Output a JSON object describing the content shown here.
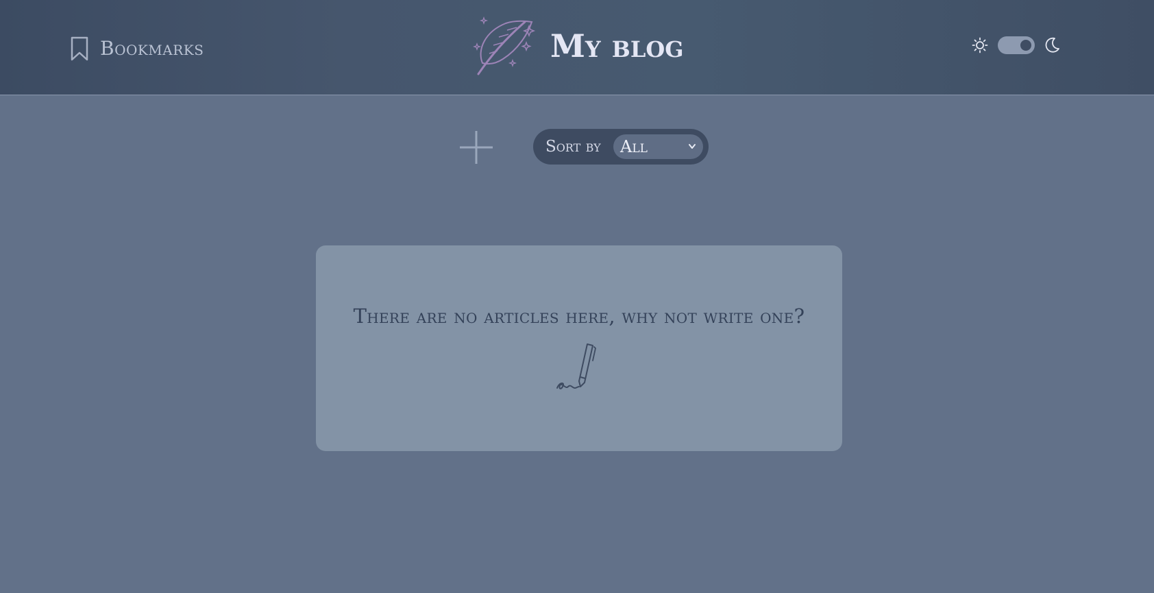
{
  "header": {
    "bookmarks_label": "Bookmarks",
    "title": "My blog",
    "logo_icon": "feather-sparkles-icon",
    "theme_toggle": {
      "light_icon": "sun-icon",
      "dark_icon": "moon-icon",
      "state": "dark"
    }
  },
  "toolbar": {
    "add_icon": "plus-icon",
    "sort_label": "Sort by",
    "sort_selected": "All"
  },
  "empty_state": {
    "message": "There are no articles here, why not write one?",
    "icon": "pen-signature-icon"
  },
  "colors": {
    "background": "#627189",
    "header": "#46566d",
    "card": "#8393a6",
    "accent": "#9d84b7",
    "title": "#e4e6f4"
  }
}
